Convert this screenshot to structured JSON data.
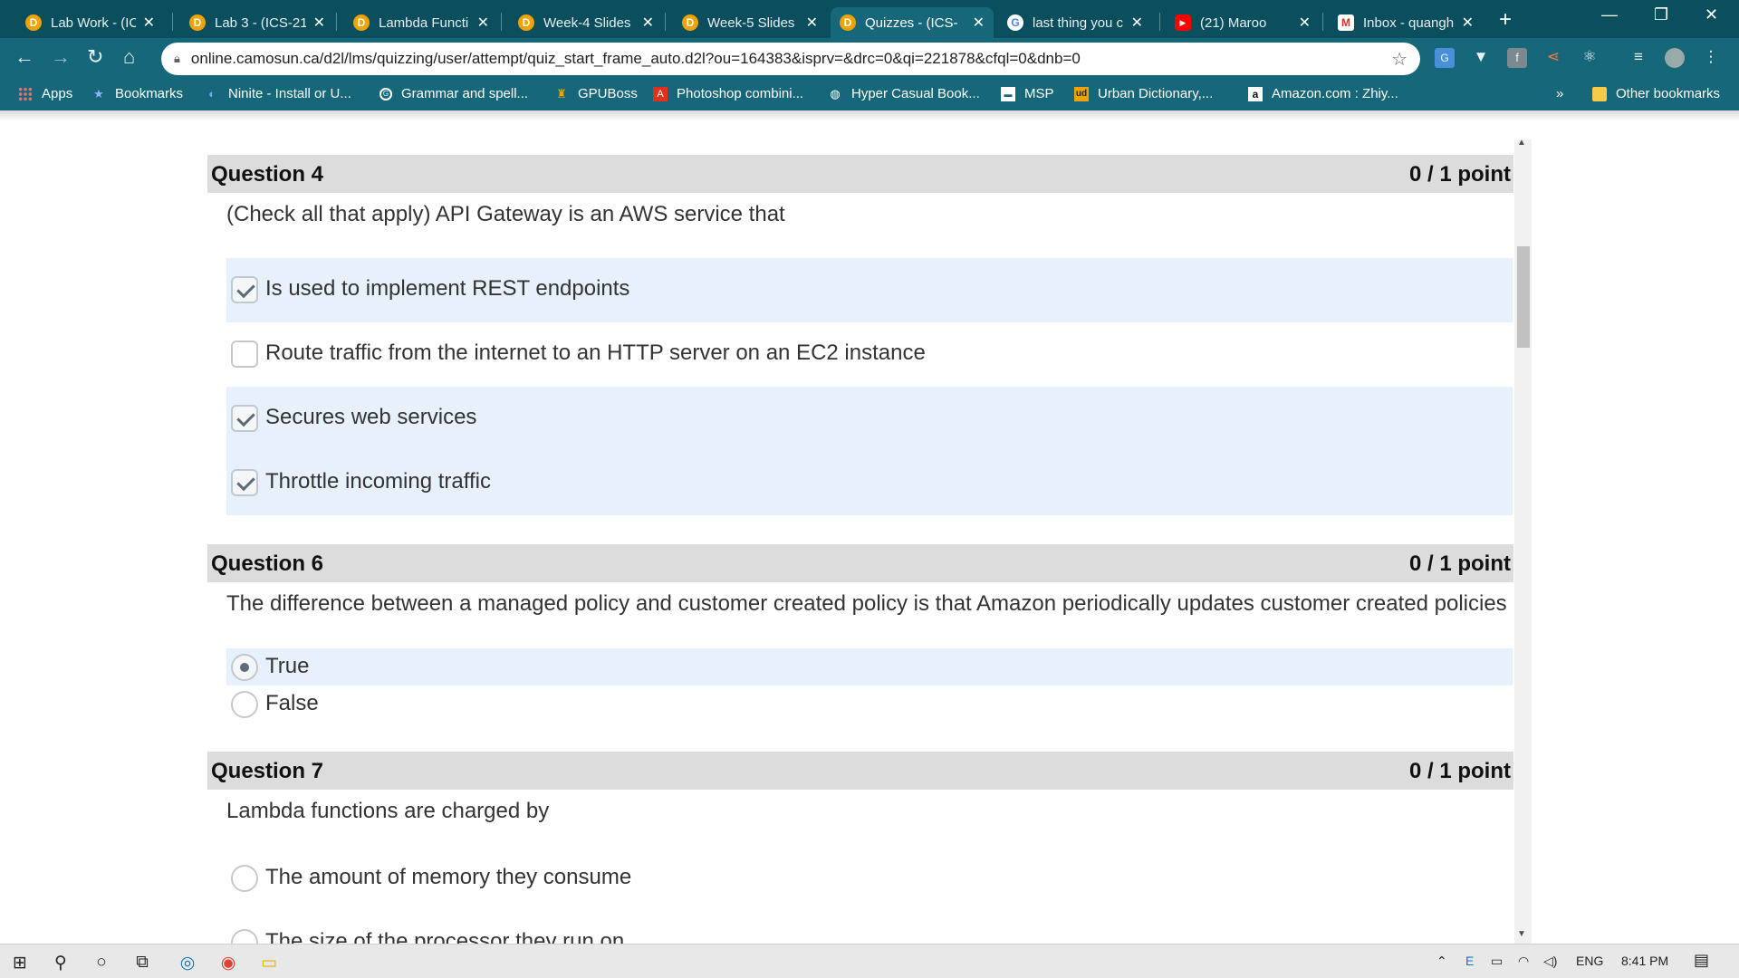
{
  "tabs": [
    {
      "label": "Lab Work - (ICS",
      "icon": "d2l-icon",
      "active": false
    },
    {
      "label": "Lab 3 - (ICS-21",
      "icon": "d2l-icon",
      "active": false
    },
    {
      "label": "Lambda Functi",
      "icon": "d2l-icon",
      "active": false
    },
    {
      "label": "Week-4 Slides",
      "icon": "d2l-icon",
      "active": false
    },
    {
      "label": "Week-5 Slides",
      "icon": "d2l-icon",
      "active": false
    },
    {
      "label": "Quizzes - (ICS-",
      "icon": "d2l-icon",
      "active": true
    },
    {
      "label": "last thing you c",
      "icon": "google-icon",
      "active": false
    },
    {
      "label": "(21) Maroo",
      "icon": "youtube-icon",
      "active": false
    },
    {
      "label": "Inbox - quangh",
      "icon": "gmail-icon",
      "active": false
    }
  ],
  "address_bar": {
    "url": "online.camosun.ca/d2l/lms/quizzing/user/attempt/quiz_start_frame_auto.d2l?ou=164383&isprv=&drc=0&qi=221878&cfql=0&dnb=0"
  },
  "bookmarks": [
    {
      "label": "Apps",
      "icon": "apps-grid-icon"
    },
    {
      "label": "Bookmarks",
      "icon": "star-icon"
    },
    {
      "label": "Ninite - Install or U...",
      "icon": "ninite-icon"
    },
    {
      "label": "Grammar and spell...",
      "icon": "grammar-icon"
    },
    {
      "label": "GPUBoss",
      "icon": "gpuboss-icon"
    },
    {
      "label": "Photoshop combini...",
      "icon": "adobe-icon"
    },
    {
      "label": "Hyper Casual Book...",
      "icon": "chrome-icon"
    },
    {
      "label": "MSP",
      "icon": "msp-icon"
    },
    {
      "label": "Urban Dictionary,...",
      "icon": "urban-dictionary-icon"
    },
    {
      "label": "Amazon.com : Zhiy...",
      "icon": "amazon-icon"
    }
  ],
  "other_bookmarks": "Other bookmarks",
  "overflow": "»",
  "questions": [
    {
      "title": "Question 4",
      "points": "0 / 1 point",
      "text": "(Check all that apply) API Gateway is an AWS service that",
      "type": "checkbox",
      "options": [
        {
          "label": "Is used to implement REST endpoints",
          "checked": true
        },
        {
          "label": "Route traffic from the internet to an HTTP server on an EC2 instance",
          "checked": false
        },
        {
          "label": "Secures web services",
          "checked": true
        },
        {
          "label": "Throttle incoming traffic",
          "checked": true
        }
      ]
    },
    {
      "title": "Question 6",
      "points": "0 / 1 point",
      "text": "The difference between a managed policy and customer created policy is that Amazon periodically updates customer created policies",
      "type": "radio",
      "options": [
        {
          "label": "True",
          "checked": true
        },
        {
          "label": "False",
          "checked": false
        }
      ]
    },
    {
      "title": "Question 7",
      "points": "0 / 1 point",
      "text": "Lambda functions are charged by",
      "type": "radio",
      "options": [
        {
          "label": "The amount of memory they consume",
          "checked": false
        },
        {
          "label": "The size of the processor they run on",
          "checked": false
        }
      ]
    }
  ],
  "taskbar": {
    "language": "ENG",
    "time": "8:41 PM"
  }
}
